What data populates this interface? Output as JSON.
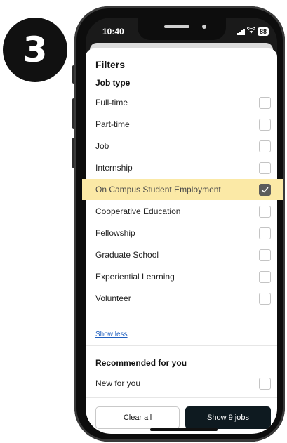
{
  "step": {
    "number": "3"
  },
  "status_bar": {
    "time": "10:40",
    "battery": "88"
  },
  "sheet": {
    "title": "Filters",
    "job_type": {
      "heading": "Job type",
      "options": [
        {
          "label": "Full-time",
          "checked": false
        },
        {
          "label": "Part-time",
          "checked": false
        },
        {
          "label": "Job",
          "checked": false
        },
        {
          "label": "Internship",
          "checked": false
        },
        {
          "label": "On Campus Student Employment",
          "checked": true
        },
        {
          "label": "Cooperative Education",
          "checked": false
        },
        {
          "label": "Fellowship",
          "checked": false
        },
        {
          "label": "Graduate School",
          "checked": false
        },
        {
          "label": "Experiential Learning",
          "checked": false
        },
        {
          "label": "Volunteer",
          "checked": false
        }
      ],
      "show_less": "Show less"
    },
    "recommended": {
      "heading": "Recommended for you",
      "options": [
        {
          "label": "New for you",
          "checked": false
        }
      ]
    }
  },
  "actions": {
    "clear_label": "Clear all",
    "show_label": "Show 9 jobs"
  },
  "colors": {
    "highlight": "#fbe9a6",
    "primary_button": "#0e1a20",
    "checked_box": "#5b5b5b",
    "link": "#1f5fbf"
  }
}
